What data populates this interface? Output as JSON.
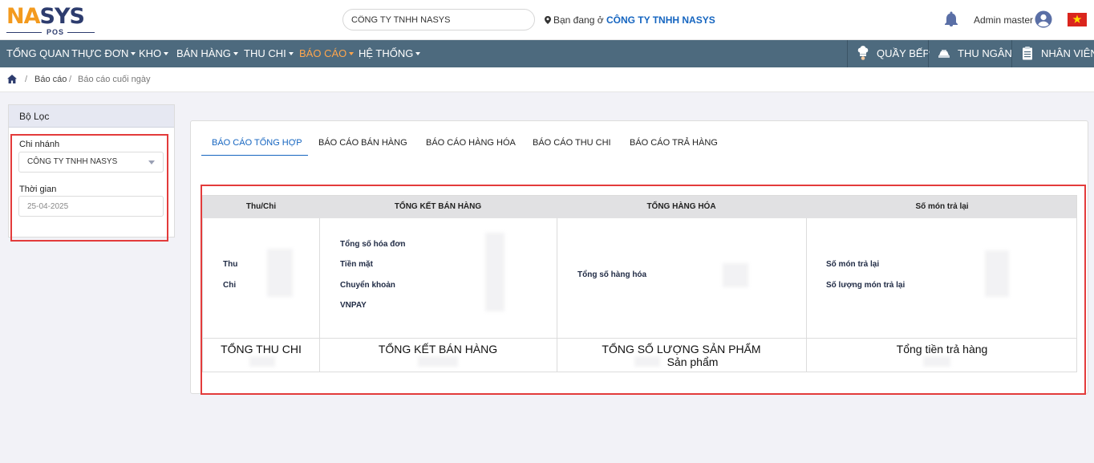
{
  "header": {
    "logo": {
      "text_part1": "NA",
      "text_part2": "S",
      "text_part3": "YS",
      "sub": "POS"
    },
    "company_search_value": "CÔNG TY TNHH NASYS",
    "location_prefix": "Bạn đang ở",
    "location_company": "CÔNG TY TNHH NASYS",
    "admin_name": "Admin master"
  },
  "nav": {
    "items": [
      {
        "label": "TỔNG QUAN",
        "has_caret": false
      },
      {
        "label": "THỰC ĐƠN",
        "has_caret": true
      },
      {
        "label": "KHO",
        "has_caret": true
      },
      {
        "label": "BÁN HÀNG",
        "has_caret": true
      },
      {
        "label": "THU CHI",
        "has_caret": true
      },
      {
        "label": "BÁO CÁO",
        "has_caret": true,
        "active": true
      },
      {
        "label": "HỆ THỐNG",
        "has_caret": true
      }
    ],
    "right": [
      {
        "label": "QUẦY BẾP",
        "icon": "chef-icon"
      },
      {
        "label": "THU NGÂN",
        "icon": "cashier-icon"
      },
      {
        "label": "NHÂN VIÊN",
        "icon": "staff-clipboard-icon"
      }
    ],
    "active_color": "#ffa64d",
    "bar_color": "#4d6a7e"
  },
  "breadcrumb": {
    "sep": "/",
    "items": [
      "Báo cáo",
      "Báo cáo cuối ngày"
    ]
  },
  "filter": {
    "title": "Bộ Lọc",
    "branch_label": "Chi nhánh",
    "branch_value": "CÔNG TY TNHH NASYS",
    "time_label": "Thời gian",
    "time_value": "25-04-2025"
  },
  "tabs": [
    {
      "label": "BÁO CÁO TỔNG HỢP",
      "active": true
    },
    {
      "label": "BÁO CÁO BÁN HÀNG"
    },
    {
      "label": "BÁO CÁO HÀNG HÓA"
    },
    {
      "label": "BÁO CÁO THU CHI"
    },
    {
      "label": "BÁO CÁO TRẢ HÀNG"
    }
  ],
  "report": {
    "columns": [
      "Thu/Chi",
      "TỔNG KẾT BÁN HÀNG",
      "TỔNG HÀNG HÓA",
      "Số món trả lại"
    ],
    "thu_chi": {
      "labels": [
        "Thu",
        "Chi"
      ],
      "total": "TỔNG THU CHI"
    },
    "ban_hang": {
      "labels": [
        "Tổng số hóa đơn",
        "Tiền mặt",
        "Chuyển khoản",
        "VNPAY"
      ],
      "total": "TỔNG KẾT BÁN HÀNG"
    },
    "hang_hoa": {
      "labels": [
        "Tổng số hàng hóa"
      ],
      "total": "TỔNG SỐ LƯỢNG SẢN PHẨM",
      "unit": "Sản phẩm"
    },
    "tra_hang": {
      "labels": [
        "Số món trả lại",
        "Số lượng món trả lại"
      ],
      "total": "Tổng tiền trả hàng"
    }
  },
  "colors": {
    "accent_blue": "#1565c0",
    "highlight_red": "#e33b3b",
    "logo_orange": "#f39a1e",
    "logo_navy": "#2d3c6e"
  }
}
